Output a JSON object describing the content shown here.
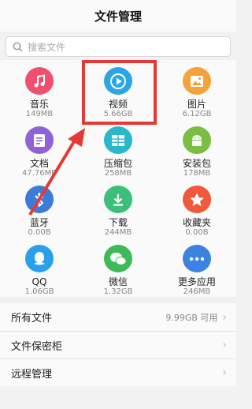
{
  "header": {
    "title": "文件管理"
  },
  "search": {
    "placeholder": "搜索文件"
  },
  "grid": [
    {
      "label": "音乐",
      "size": "149MB",
      "icon": "music-icon",
      "color": "#f0506e"
    },
    {
      "label": "视频",
      "size": "5.66GB",
      "icon": "video-play-icon",
      "color": "#2aa5e6"
    },
    {
      "label": "图片",
      "size": "6.12GB",
      "icon": "picture-icon",
      "color": "#f4a23a"
    },
    {
      "label": "文档",
      "size": "47.76MB",
      "icon": "document-icon",
      "color": "#8f63d6"
    },
    {
      "label": "压缩包",
      "size": "258MB",
      "icon": "archive-icon",
      "color": "#28b8c9"
    },
    {
      "label": "安装包",
      "size": "178MB",
      "icon": "android-icon",
      "color": "#7bbf42"
    },
    {
      "label": "蓝牙",
      "size": "0.00B",
      "icon": "bluetooth-icon",
      "color": "#3d7bd9"
    },
    {
      "label": "下载",
      "size": "244MB",
      "icon": "download-icon",
      "color": "#3bbf7a"
    },
    {
      "label": "收藏夹",
      "size": "0.00B",
      "icon": "star-icon",
      "color": "#ef5a3c"
    },
    {
      "label": "QQ",
      "size": "1.06GB",
      "icon": "qq-icon",
      "color": "#2aa0ea"
    },
    {
      "label": "微信",
      "size": "1.32GB",
      "icon": "wechat-icon",
      "color": "#3dbb5a"
    },
    {
      "label": "更多应用",
      "size": "246MB",
      "icon": "more-icon",
      "color": "#3a83e0"
    }
  ],
  "list": {
    "all_files": {
      "label": "所有文件",
      "extra": "9.99GB 可用"
    },
    "vault": {
      "label": "文件保密柜"
    },
    "remote": {
      "label": "远程管理"
    }
  },
  "colors": {
    "highlight": "#e53935"
  }
}
